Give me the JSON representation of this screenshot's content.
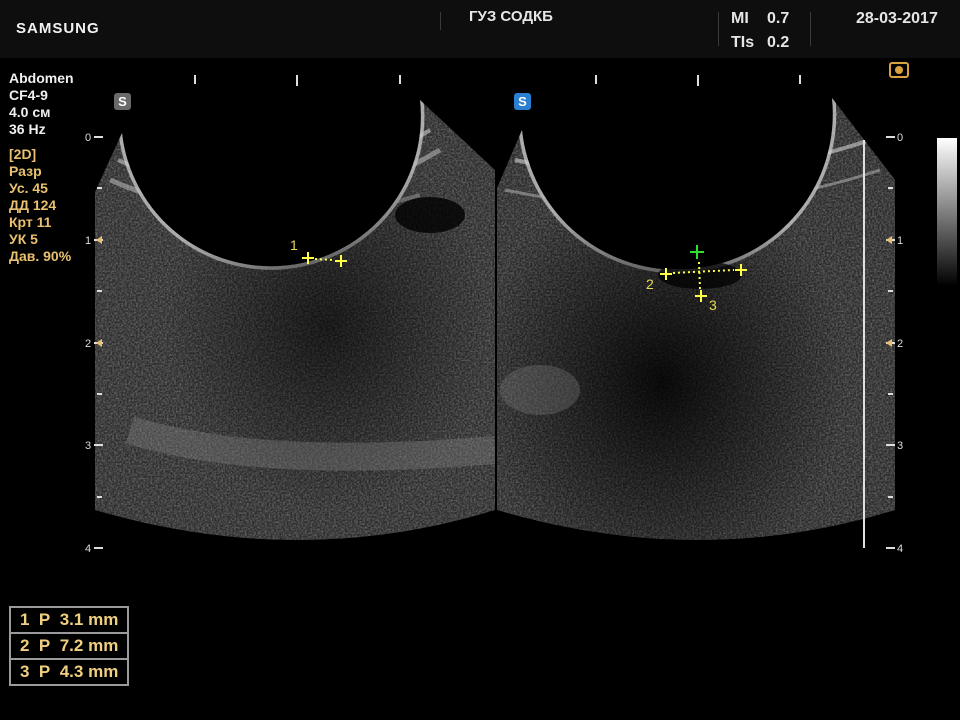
{
  "header": {
    "brand": "SAMSUNG",
    "hospital": "ГУЗ СОДКБ",
    "mi_label": "MI",
    "mi_value": "0.7",
    "tis_label": "TIs",
    "tis_value": "0.2",
    "date": "28-03-2017"
  },
  "params": {
    "preset": "Abdomen",
    "probe": "CF4-9",
    "depth": "4.0 см",
    "frame_rate": "36 Hz",
    "mode": "[2D]",
    "res": "Разр",
    "gain": "Ус.  45",
    "dr": "ДД  124",
    "frq": "Крт 11",
    "uk": "УК  5",
    "power": "Дав. 90%"
  },
  "depth_scale": {
    "ticks": [
      "0",
      "1",
      "2",
      "3",
      "4"
    ]
  },
  "left_image": {
    "badge": "S",
    "badge_color": "#6a6a6a",
    "markers": [
      "1"
    ]
  },
  "right_image": {
    "badge": "S",
    "badge_color": "#2a7fd0",
    "markers": [
      "2",
      "3"
    ]
  },
  "measurements": [
    {
      "num": "1",
      "type": "P",
      "value": "3.1 mm"
    },
    {
      "num": "2",
      "type": "P",
      "value": "7.2 mm"
    },
    {
      "num": "3",
      "type": "P",
      "value": "4.3 mm"
    }
  ],
  "colors": {
    "caliper": "#ffff44",
    "active_caliper": "#30e030",
    "param_text": "#e8c070"
  }
}
